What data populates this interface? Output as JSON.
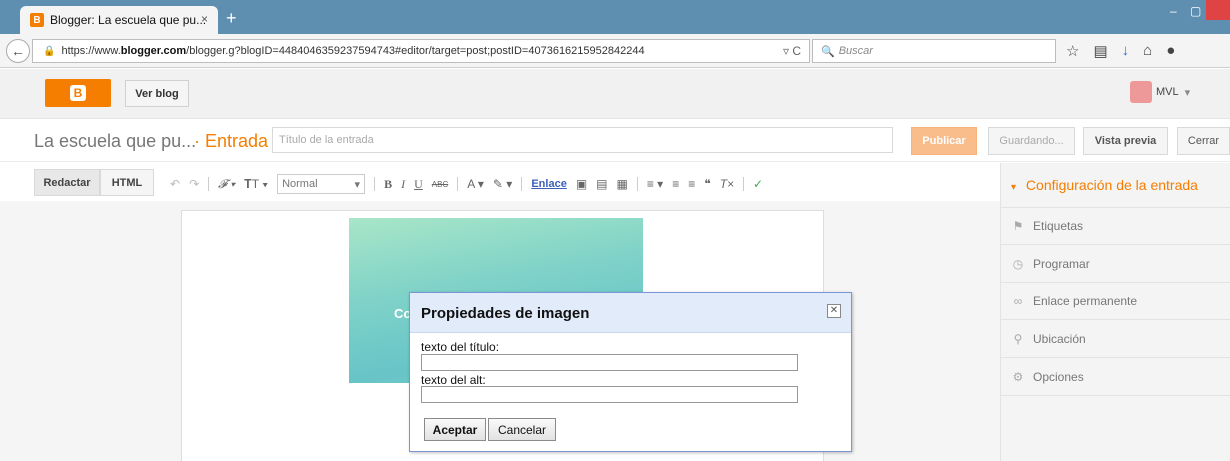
{
  "browser": {
    "tab_title": "Blogger: La escuela que pu...",
    "tab_close": "×",
    "new_tab": "+",
    "url_prefix": "https://www.",
    "url_domain": "blogger.com",
    "url_rest": "/blogger.g?blogID=4484046359237594743#editor/target=post;postID=4073616215952842244",
    "search_placeholder": "Buscar",
    "window_minimize": "–",
    "window_maximize": "▢"
  },
  "blogger_bar": {
    "view_blog": "Ver blog",
    "user": "MVL"
  },
  "title_row": {
    "blog_name": "La escuela que pu...",
    "section": "· Entrada",
    "title_placeholder": "Título de la entrada",
    "publish": "Publicar",
    "saving": "Guardando...",
    "preview": "Vista previa",
    "close": "Cerrar"
  },
  "toolbar": {
    "compose": "Redactar",
    "html": "HTML",
    "font_size": "Normal",
    "link": "Enlace"
  },
  "editor": {
    "image_caption": "Co"
  },
  "sidebar": {
    "header": "Configuración de la entrada",
    "items": [
      {
        "label": "Etiquetas",
        "icon": "tag-icon"
      },
      {
        "label": "Programar",
        "icon": "clock-icon"
      },
      {
        "label": "Enlace permanente",
        "icon": "link-icon"
      },
      {
        "label": "Ubicación",
        "icon": "location-pin-icon"
      },
      {
        "label": "Opciones",
        "icon": "gear-icon"
      }
    ]
  },
  "dialog": {
    "title": "Propiedades de imagen",
    "title_label": "texto del título:",
    "title_value": "",
    "alt_label": "texto del alt:",
    "alt_value": "",
    "accept": "Aceptar",
    "cancel": "Cancelar"
  },
  "colors": {
    "blogger_orange": "#f57d00",
    "tabbar": "#5e8fb1",
    "dialog_header": "#e1ebfa"
  }
}
